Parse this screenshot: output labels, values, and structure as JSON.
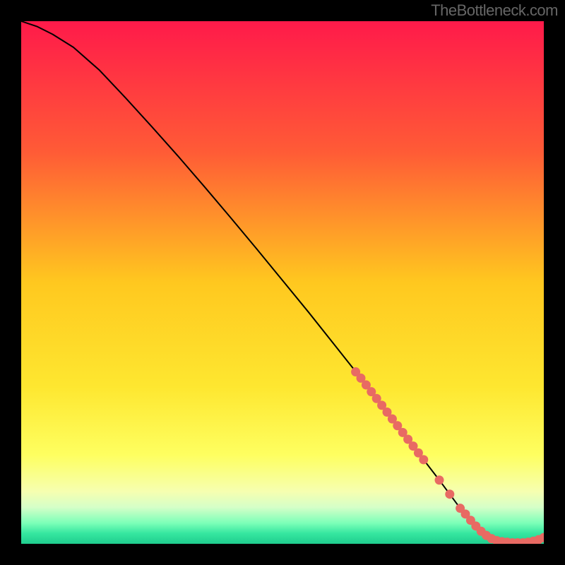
{
  "watermark": "TheBottleneck.com",
  "chart_data": {
    "type": "line",
    "title": "",
    "xlabel": "",
    "ylabel": "",
    "xlim": [
      0,
      100
    ],
    "ylim": [
      0,
      100
    ],
    "series": [
      {
        "name": "bottleneck-curve",
        "x": [
          0,
          3,
          6,
          10,
          15,
          20,
          25,
          30,
          35,
          40,
          45,
          50,
          55,
          60,
          65,
          70,
          75,
          80,
          82,
          84,
          86,
          88,
          90,
          92,
          94,
          96,
          98,
          100
        ],
        "y": [
          100,
          99,
          97.5,
          95,
          90.6,
          85.3,
          79.8,
          74.2,
          68.4,
          62.5,
          56.5,
          50.4,
          44.3,
          38.0,
          31.7,
          25.2,
          18.7,
          12.2,
          9.5,
          6.8,
          4.5,
          2.4,
          1.0,
          0.4,
          0.2,
          0.2,
          0.5,
          1.2
        ]
      }
    ],
    "highlights": {
      "name": "segment-markers",
      "x": [
        64,
        65,
        66,
        67,
        68,
        69,
        70,
        71,
        72,
        73,
        74,
        75,
        76,
        77,
        80,
        82,
        84,
        85,
        86,
        87,
        88,
        89,
        90,
        91,
        92,
        93,
        94,
        95,
        96,
        97,
        98,
        99,
        100
      ],
      "y": [
        32.9,
        31.7,
        30.4,
        29.1,
        27.8,
        26.5,
        25.2,
        23.9,
        22.6,
        21.3,
        20.0,
        18.7,
        17.4,
        16.1,
        12.2,
        9.5,
        6.8,
        5.7,
        4.5,
        3.4,
        2.4,
        1.6,
        1.0,
        0.6,
        0.4,
        0.3,
        0.2,
        0.2,
        0.2,
        0.3,
        0.5,
        0.8,
        1.2
      ]
    },
    "background_gradient": {
      "stops": [
        {
          "offset": 0,
          "color": "#ff1a4a"
        },
        {
          "offset": 25,
          "color": "#ff5b36"
        },
        {
          "offset": 50,
          "color": "#ffc81f"
        },
        {
          "offset": 70,
          "color": "#fee730"
        },
        {
          "offset": 83,
          "color": "#feff60"
        },
        {
          "offset": 90,
          "color": "#f6ffb0"
        },
        {
          "offset": 93,
          "color": "#d5ffc8"
        },
        {
          "offset": 96,
          "color": "#7dffb8"
        },
        {
          "offset": 98,
          "color": "#36e7a0"
        },
        {
          "offset": 100,
          "color": "#1fcd8e"
        }
      ]
    }
  }
}
